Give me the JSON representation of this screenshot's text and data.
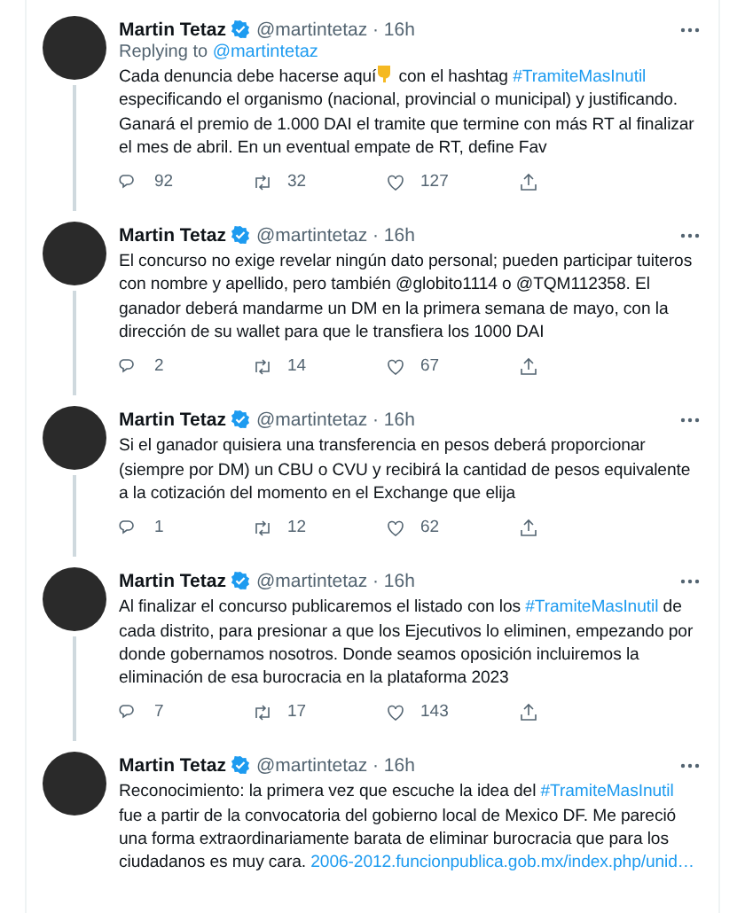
{
  "tweets": [
    {
      "name": "Martin Tetaz",
      "handle": "@martintetaz",
      "separator": "·",
      "time": "16h",
      "replying_label": "Replying to",
      "replying_to": "@martintetaz",
      "thread": true,
      "body": [
        {
          "kind": "text",
          "text": "Cada denuncia debe hacerse aquí"
        },
        {
          "kind": "emoji"
        },
        {
          "kind": "text",
          "text": " con el hashtag "
        },
        {
          "kind": "hashtag",
          "text": "#TramiteMasInutil"
        },
        {
          "kind": "text",
          "text": " especificando el organismo (nacional, provincial o municipal) y justificando. Ganará el premio de 1.000 DAI el tramite que termine con más RT al finalizar el mes de abril. En un eventual empate de RT, define Fav"
        }
      ],
      "replies": "92",
      "retweets": "32",
      "likes": "127"
    },
    {
      "name": "Martin Tetaz",
      "handle": "@martintetaz",
      "separator": "·",
      "time": "16h",
      "thread": true,
      "body": [
        {
          "kind": "text",
          "text": "El concurso no exige revelar ningún dato personal; pueden participar tuiteros con nombre y apellido, pero también @globito1114 o @TQM112358. El ganador deberá mandarme un DM en la primera semana de mayo, con la dirección de su wallet para que le transfiera los 1000 DAI"
        }
      ],
      "replies": "2",
      "retweets": "14",
      "likes": "67"
    },
    {
      "name": "Martin Tetaz",
      "handle": "@martintetaz",
      "separator": "·",
      "time": "16h",
      "thread": true,
      "body": [
        {
          "kind": "text",
          "text": "Si el ganador quisiera una transferencia en pesos deberá proporcionar (siempre por DM) un CBU o CVU y recibirá la cantidad de pesos equivalente a la cotización del momento en el Exchange que elija"
        }
      ],
      "replies": "1",
      "retweets": "12",
      "likes": "62"
    },
    {
      "name": "Martin Tetaz",
      "handle": "@martintetaz",
      "separator": "·",
      "time": "16h",
      "thread": true,
      "body": [
        {
          "kind": "text",
          "text": "Al finalizar el concurso publicaremos el listado con los "
        },
        {
          "kind": "hashtag",
          "text": "#TramiteMasInutil"
        },
        {
          "kind": "text",
          "text": " de cada distrito, para presionar a que los Ejecutivos lo eliminen, empezando por donde gobernamos nosotros. Donde seamos oposición incluiremos la eliminación de esa burocracia en la plataforma 2023"
        }
      ],
      "replies": "7",
      "retweets": "17",
      "likes": "143"
    },
    {
      "name": "Martin Tetaz",
      "handle": "@martintetaz",
      "separator": "·",
      "time": "16h",
      "thread": false,
      "body": [
        {
          "kind": "text",
          "text": "Reconocimiento: la primera vez que escuche la idea del "
        },
        {
          "kind": "hashtag",
          "text": "#TramiteMasInutil"
        },
        {
          "kind": "text",
          "text": " fue a partir de la convocatoria del gobierno local de Mexico DF. Me pareció una forma extraordinariamente barata de eliminar burocracia que para los ciudadanos es muy cara. "
        },
        {
          "kind": "link",
          "text": "2006-2012.funcionpublica.gob.mx/index.php/unid…"
        }
      ]
    }
  ]
}
